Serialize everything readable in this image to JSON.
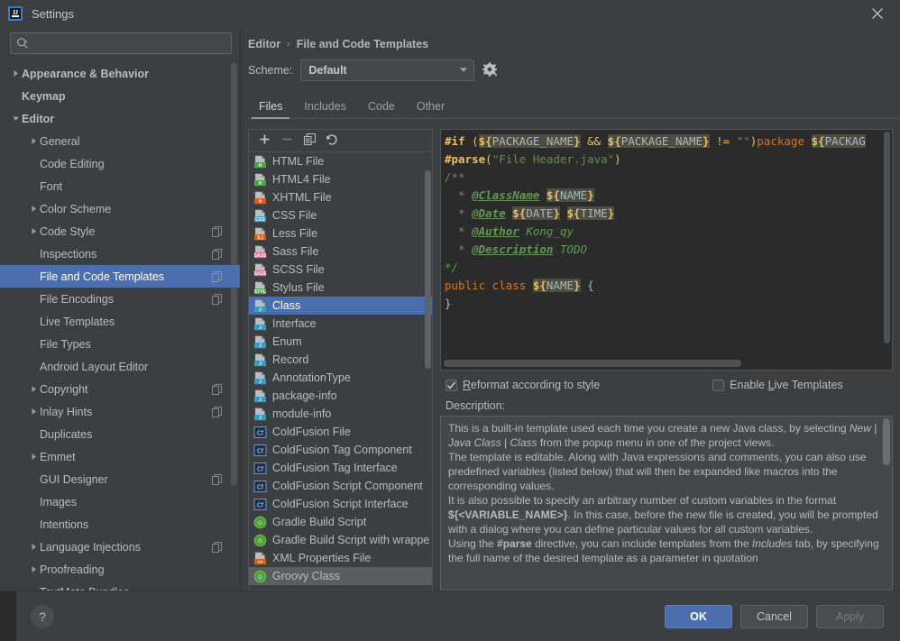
{
  "window": {
    "title": "Settings",
    "logo_text": "IJ",
    "close_icon": "close-icon"
  },
  "sidebar": {
    "search": {
      "placeholder": "",
      "value": "",
      "icon": "search-icon"
    },
    "items": [
      {
        "label": "Appearance & Behavior",
        "arrow": "right",
        "indent": 0,
        "bold": true,
        "badge": false,
        "selected": false
      },
      {
        "label": "Keymap",
        "arrow": "none",
        "indent": 0,
        "bold": true,
        "badge": false,
        "selected": false
      },
      {
        "label": "Editor",
        "arrow": "down",
        "indent": 0,
        "bold": true,
        "badge": false,
        "selected": false
      },
      {
        "label": "General",
        "arrow": "right",
        "indent": 1,
        "bold": false,
        "badge": false,
        "selected": false
      },
      {
        "label": "Code Editing",
        "arrow": "none",
        "indent": 1,
        "bold": false,
        "badge": false,
        "selected": false
      },
      {
        "label": "Font",
        "arrow": "none",
        "indent": 1,
        "bold": false,
        "badge": false,
        "selected": false
      },
      {
        "label": "Color Scheme",
        "arrow": "right",
        "indent": 1,
        "bold": false,
        "badge": false,
        "selected": false
      },
      {
        "label": "Code Style",
        "arrow": "right",
        "indent": 1,
        "bold": false,
        "badge": true,
        "selected": false
      },
      {
        "label": "Inspections",
        "arrow": "none",
        "indent": 1,
        "bold": false,
        "badge": true,
        "selected": false
      },
      {
        "label": "File and Code Templates",
        "arrow": "none",
        "indent": 1,
        "bold": false,
        "badge": true,
        "selected": true
      },
      {
        "label": "File Encodings",
        "arrow": "none",
        "indent": 1,
        "bold": false,
        "badge": true,
        "selected": false
      },
      {
        "label": "Live Templates",
        "arrow": "none",
        "indent": 1,
        "bold": false,
        "badge": false,
        "selected": false
      },
      {
        "label": "File Types",
        "arrow": "none",
        "indent": 1,
        "bold": false,
        "badge": false,
        "selected": false
      },
      {
        "label": "Android Layout Editor",
        "arrow": "none",
        "indent": 1,
        "bold": false,
        "badge": false,
        "selected": false
      },
      {
        "label": "Copyright",
        "arrow": "right",
        "indent": 1,
        "bold": false,
        "badge": true,
        "selected": false
      },
      {
        "label": "Inlay Hints",
        "arrow": "right",
        "indent": 1,
        "bold": false,
        "badge": true,
        "selected": false
      },
      {
        "label": "Duplicates",
        "arrow": "none",
        "indent": 1,
        "bold": false,
        "badge": false,
        "selected": false
      },
      {
        "label": "Emmet",
        "arrow": "right",
        "indent": 1,
        "bold": false,
        "badge": false,
        "selected": false
      },
      {
        "label": "GUI Designer",
        "arrow": "none",
        "indent": 1,
        "bold": false,
        "badge": true,
        "selected": false
      },
      {
        "label": "Images",
        "arrow": "none",
        "indent": 1,
        "bold": false,
        "badge": false,
        "selected": false
      },
      {
        "label": "Intentions",
        "arrow": "none",
        "indent": 1,
        "bold": false,
        "badge": false,
        "selected": false
      },
      {
        "label": "Language Injections",
        "arrow": "right",
        "indent": 1,
        "bold": false,
        "badge": true,
        "selected": false
      },
      {
        "label": "Proofreading",
        "arrow": "right",
        "indent": 1,
        "bold": false,
        "badge": false,
        "selected": false
      },
      {
        "label": "TextMate Bundles",
        "arrow": "none",
        "indent": 1,
        "bold": false,
        "badge": false,
        "selected": false
      }
    ]
  },
  "breadcrumb": {
    "root": "Editor",
    "separator": "›",
    "current": "File and Code Templates"
  },
  "scheme": {
    "label": "Scheme:",
    "value": "Default",
    "gear_icon": "gear-icon",
    "caret_icon": "chevron-down-icon"
  },
  "tabs": [
    {
      "label": "Files",
      "active": true
    },
    {
      "label": "Includes",
      "active": false
    },
    {
      "label": "Code",
      "active": false
    },
    {
      "label": "Other",
      "active": false
    }
  ],
  "templates": {
    "toolbar": [
      {
        "name": "add-template-button",
        "icon": "plus-icon",
        "enabled": true
      },
      {
        "name": "remove-template-button",
        "icon": "minus-icon",
        "enabled": false
      },
      {
        "name": "copy-template-button",
        "icon": "copy-icon",
        "enabled": true
      },
      {
        "name": "reset-template-button",
        "icon": "undo-icon",
        "enabled": true
      }
    ],
    "items": [
      {
        "label": "HTML File",
        "icon": "html-file-icon",
        "badge": "H",
        "badge_color": "#4f9e4f",
        "selected": false
      },
      {
        "label": "HTML4 File",
        "icon": "html4-file-icon",
        "badge": "H",
        "badge_color": "#4f9e4f",
        "selected": false
      },
      {
        "label": "XHTML File",
        "icon": "xhtml-file-icon",
        "badge": "H",
        "badge_color": "#d2601a",
        "selected": false
      },
      {
        "label": "CSS File",
        "icon": "css-file-icon",
        "badge": "CSS",
        "badge_color": "#3a9bbf",
        "selected": false
      },
      {
        "label": "Less File",
        "icon": "less-file-icon",
        "badge": "{L}",
        "badge_color": "#d2601a",
        "selected": false
      },
      {
        "label": "Sass File",
        "icon": "sass-file-icon",
        "badge": "SASS",
        "badge_color": "#cf6b8a",
        "selected": false
      },
      {
        "label": "SCSS File",
        "icon": "scss-file-icon",
        "badge": "SASS",
        "badge_color": "#cf6b8a",
        "selected": false
      },
      {
        "label": "Stylus File",
        "icon": "stylus-file-icon",
        "badge": "STYL",
        "badge_color": "#4f9e4f",
        "selected": false
      },
      {
        "label": "Class",
        "icon": "java-class-icon",
        "badge": "J",
        "badge_color": "#3a9bbf",
        "selected": true
      },
      {
        "label": "Interface",
        "icon": "java-interface-icon",
        "badge": "J",
        "badge_color": "#3a9bbf",
        "selected": false
      },
      {
        "label": "Enum",
        "icon": "java-enum-icon",
        "badge": "J",
        "badge_color": "#3a9bbf",
        "selected": false
      },
      {
        "label": "Record",
        "icon": "java-record-icon",
        "badge": "J",
        "badge_color": "#3a9bbf",
        "selected": false
      },
      {
        "label": "AnnotationType",
        "icon": "java-annotation-icon",
        "badge": "J",
        "badge_color": "#3a9bbf",
        "selected": false
      },
      {
        "label": "package-info",
        "icon": "java-package-info-icon",
        "badge": "J",
        "badge_color": "#3a9bbf",
        "selected": false
      },
      {
        "label": "module-info",
        "icon": "java-module-info-icon",
        "badge": "J",
        "badge_color": "#3a9bbf",
        "selected": false
      },
      {
        "label": "ColdFusion File",
        "icon": "coldfusion-file-icon",
        "badge": "Cf",
        "badge_color": "#2b4f8a",
        "selected": false
      },
      {
        "label": "ColdFusion Tag Component",
        "icon": "coldfusion-tag-component-icon",
        "badge": "Cf",
        "badge_color": "#2b4f8a",
        "selected": false
      },
      {
        "label": "ColdFusion Tag Interface",
        "icon": "coldfusion-tag-interface-icon",
        "badge": "Cf",
        "badge_color": "#2b4f8a",
        "selected": false
      },
      {
        "label": "ColdFusion Script Component",
        "icon": "coldfusion-script-component-icon",
        "badge": "Cf",
        "badge_color": "#2b4f8a",
        "selected": false
      },
      {
        "label": "ColdFusion Script Interface",
        "icon": "coldfusion-script-interface-icon",
        "badge": "Cf",
        "badge_color": "#2b4f8a",
        "selected": false
      },
      {
        "label": "Gradle Build Script",
        "icon": "gradle-icon",
        "badge": "G",
        "badge_color": "#5aa02c",
        "selected": false
      },
      {
        "label": "Gradle Build Script with wrappe",
        "icon": "gradle-wrapper-icon",
        "badge": "G",
        "badge_color": "#5aa02c",
        "selected": false
      },
      {
        "label": "XML Properties File",
        "icon": "xml-properties-icon",
        "badge": "<>",
        "badge_color": "#d2601a",
        "selected": false
      },
      {
        "label": "Groovy Class",
        "icon": "groovy-class-icon",
        "badge": "G",
        "badge_color": "#5aa02c",
        "selected": false
      }
    ]
  },
  "editor": {
    "lines": [
      [
        {
          "t": "#if",
          "c": "tok-dir"
        },
        {
          "t": " ",
          "c": "tok-plain"
        },
        {
          "t": "(",
          "c": "tok-paren"
        },
        {
          "t": "${",
          "c": "tok-vard"
        },
        {
          "t": "PACKAGE_NAME",
          "c": "tok-varn"
        },
        {
          "t": "}",
          "c": "tok-vard"
        },
        {
          "t": " ",
          "c": "tok-plain"
        },
        {
          "t": "&&",
          "c": "tok-op"
        },
        {
          "t": " ",
          "c": "tok-plain"
        },
        {
          "t": "${",
          "c": "tok-vard"
        },
        {
          "t": "PACKAGE_NAME",
          "c": "tok-varn"
        },
        {
          "t": "}",
          "c": "tok-vard"
        },
        {
          "t": " ",
          "c": "tok-plain"
        },
        {
          "t": "!=",
          "c": "tok-op"
        },
        {
          "t": " ",
          "c": "tok-plain"
        },
        {
          "t": "\"\"",
          "c": "tok-str"
        },
        {
          "t": ")",
          "c": "tok-paren"
        },
        {
          "t": "package ",
          "c": "tok-kw"
        },
        {
          "t": "${",
          "c": "tok-vard"
        },
        {
          "t": "PACKAG",
          "c": "tok-varn"
        }
      ],
      [
        {
          "t": "#parse",
          "c": "tok-dir"
        },
        {
          "t": "(",
          "c": "tok-paren"
        },
        {
          "t": "\"File Header.java\"",
          "c": "tok-str"
        },
        {
          "t": ")",
          "c": "tok-paren"
        }
      ],
      [
        {
          "t": "/**",
          "c": "tok-doc"
        }
      ],
      [
        {
          "t": "  * ",
          "c": "tok-doc"
        },
        {
          "t": "@ClassName",
          "c": "tok-tag"
        },
        {
          "t": " ",
          "c": "tok-plain"
        },
        {
          "t": "${",
          "c": "tok-vard"
        },
        {
          "t": "NAME",
          "c": "tok-varn"
        },
        {
          "t": "}",
          "c": "tok-vard"
        }
      ],
      [
        {
          "t": "  * ",
          "c": "tok-doc"
        },
        {
          "t": "@Date",
          "c": "tok-tag"
        },
        {
          "t": " ",
          "c": "tok-plain"
        },
        {
          "t": "${",
          "c": "tok-vard"
        },
        {
          "t": "DATE",
          "c": "tok-varn"
        },
        {
          "t": "}",
          "c": "tok-vard"
        },
        {
          "t": " ",
          "c": "tok-plain"
        },
        {
          "t": "${",
          "c": "tok-vard"
        },
        {
          "t": "TIME",
          "c": "tok-varn"
        },
        {
          "t": "}",
          "c": "tok-vard"
        }
      ],
      [
        {
          "t": "  * ",
          "c": "tok-doc"
        },
        {
          "t": "@Author",
          "c": "tok-tag"
        },
        {
          "t": " Kong_qy",
          "c": "tok-doc"
        }
      ],
      [
        {
          "t": "  * ",
          "c": "tok-doc"
        },
        {
          "t": "@Description",
          "c": "tok-tag"
        },
        {
          "t": " TODO",
          "c": "tok-doc"
        }
      ],
      [
        {
          "t": "*/",
          "c": "tok-doc"
        }
      ],
      [
        {
          "t": "public class ",
          "c": "tok-kw"
        },
        {
          "t": "${",
          "c": "tok-vard"
        },
        {
          "t": "NAME",
          "c": "tok-varn"
        },
        {
          "t": "}",
          "c": "tok-vard"
        },
        {
          "t": " {",
          "c": "tok-plain"
        }
      ],
      [
        {
          "t": "}",
          "c": "tok-plain"
        }
      ]
    ]
  },
  "options": {
    "reformat": {
      "label_pre": "R",
      "label_post": "eformat according to style",
      "checked": true
    },
    "live_templates": {
      "label_pre": "Enable ",
      "label_mid": "L",
      "label_post": "ive Templates",
      "checked": false
    }
  },
  "description": {
    "label": "Description:",
    "paragraphs": [
      "This is a built-in template used each time you create a new Java class, by selecting <i>New</i> | <i>Java Class</i> | <i>Class</i> from the popup menu in one of the project views.",
      "The template is editable. Along with Java expressions and comments, you can also use predefined variables (listed below) that will then be expanded like macros into the corresponding values.",
      "It is also possible to specify an arbitrary number of custom variables in the format <b>${&lt;VARIABLE_NAME&gt;}</b>. In this case, before the new file is created, you will be prompted with a dialog where you can define particular values for all custom variables.",
      "Using the <b>#parse</b> directive, you can include templates from the <i>Includes</i> tab, by specifying the full name of the desired template as a parameter in quotation"
    ]
  },
  "footer": {
    "help_label": "?",
    "buttons": [
      {
        "label": "OK",
        "style": "primary",
        "enabled": true,
        "name": "ok-button"
      },
      {
        "label": "Cancel",
        "style": "normal",
        "enabled": true,
        "name": "cancel-button"
      },
      {
        "label": "Apply",
        "style": "disabled",
        "enabled": false,
        "name": "apply-button"
      }
    ]
  },
  "colors": {
    "accent": "#4b6eaf",
    "window_bg": "#3c3f41",
    "editor_bg": "#2b2b2b",
    "field_bg": "#45484a",
    "text": "#bbbbbb"
  }
}
